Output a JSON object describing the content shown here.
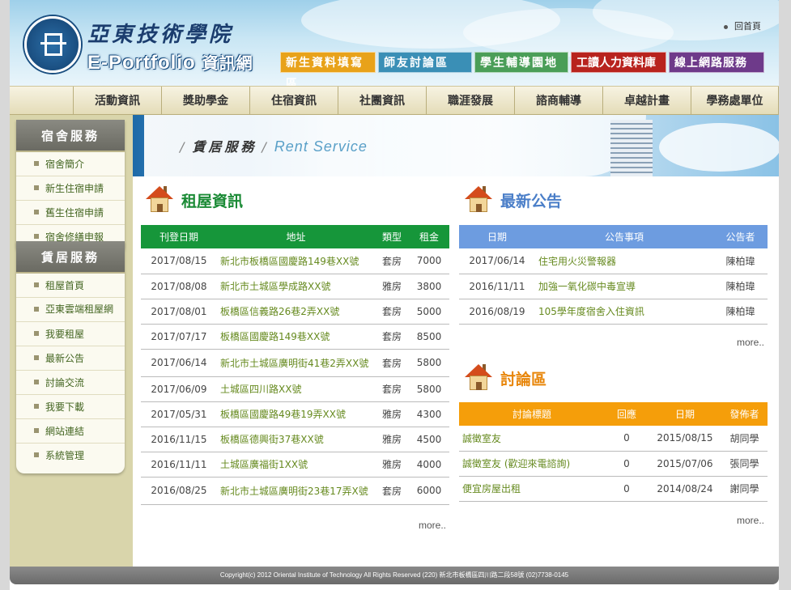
{
  "header": {
    "school_name": "亞東技術學院",
    "site_name": "E-Portfolio",
    "site_name_sub": "資訊網",
    "home_link": "回首頁",
    "top_buttons": [
      "新生資料填寫區",
      "師友討論區",
      "學生輔導園地",
      "工讀人力資料庫",
      "線上網路服務"
    ]
  },
  "nav": [
    "活動資訊",
    "獎助學金",
    "住宿資訊",
    "社團資訊",
    "職涯發展",
    "諮商輔導",
    "卓越計畫",
    "學務處單位"
  ],
  "sidebar": {
    "dorm": {
      "title": "宿舍服務",
      "items": [
        "宿舍簡介",
        "新生住宿申請",
        "舊生住宿申請",
        "宿舍修繕申報"
      ]
    },
    "rent": {
      "title": "賃居服務",
      "items": [
        "租屋首頁",
        "亞東雲端租屋網",
        "我要租屋",
        "最新公告",
        "討論交流",
        "我要下載",
        "網站連結",
        "系統管理"
      ]
    }
  },
  "banner": {
    "title": "賃居服務",
    "title_en": "Rent Service"
  },
  "rent_info": {
    "title": "租屋資訊",
    "headers": [
      "刊登日期",
      "地址",
      "類型",
      "租金"
    ],
    "rows": [
      [
        "2017/08/15",
        "新北市板橋區國慶路149巷XX號",
        "套房",
        "7000"
      ],
      [
        "2017/08/08",
        "新北市土城區學成路XX號",
        "雅房",
        "3800"
      ],
      [
        "2017/08/01",
        "板橋區信義路26巷2弄XX號",
        "套房",
        "5000"
      ],
      [
        "2017/07/17",
        "板橋區國慶路149巷XX號",
        "套房",
        "8500"
      ],
      [
        "2017/06/14",
        "新北市土城區廣明街41巷2弄XX號",
        "套房",
        "5800"
      ],
      [
        "2017/06/09",
        "土城區四川路XX號",
        "套房",
        "5800"
      ],
      [
        "2017/05/31",
        "板橋區國慶路49巷19弄XX號",
        "雅房",
        "4300"
      ],
      [
        "2016/11/15",
        "板橋區德興街37巷XX號",
        "雅房",
        "4500"
      ],
      [
        "2016/11/11",
        "土城區廣福街1XX號",
        "雅房",
        "4000"
      ],
      [
        "2016/08/25",
        "新北市土城區廣明街23巷17弄X號",
        "套房",
        "6000"
      ]
    ],
    "more": "more.."
  },
  "notices": {
    "title": "最新公告",
    "headers": [
      "日期",
      "公告事項",
      "公告者"
    ],
    "rows": [
      [
        "2017/06/14",
        "住宅用火災警報器",
        "陳柏瑋"
      ],
      [
        "2016/11/11",
        "加強一氧化碳中毒宣導",
        "陳柏瑋"
      ],
      [
        "2016/08/19",
        "105學年度宿舍入住資訊",
        "陳柏瑋"
      ]
    ],
    "more": "more.."
  },
  "forum": {
    "title": "討論區",
    "headers": [
      "討論標題",
      "回應",
      "日期",
      "發佈者"
    ],
    "rows": [
      [
        "誠徵室友",
        "0",
        "2015/08/15",
        "胡同學"
      ],
      [
        "誠徵室友 (歡迎來電諮詢)",
        "0",
        "2015/07/06",
        "張同學"
      ],
      [
        "便宜房屋出租",
        "0",
        "2014/08/24",
        "謝同學"
      ]
    ],
    "more": "more.."
  },
  "footer": "Copyright(c) 2012 Oriental Institute of Technology All Rights Reserved (220) 新北市板橋區四川路二段58號 (02)7738-0145",
  "colors": {
    "rent_header": "#16963a",
    "notice_header": "#6d9ce0",
    "forum_header": "#f59e0a",
    "link": "#668a1f"
  }
}
